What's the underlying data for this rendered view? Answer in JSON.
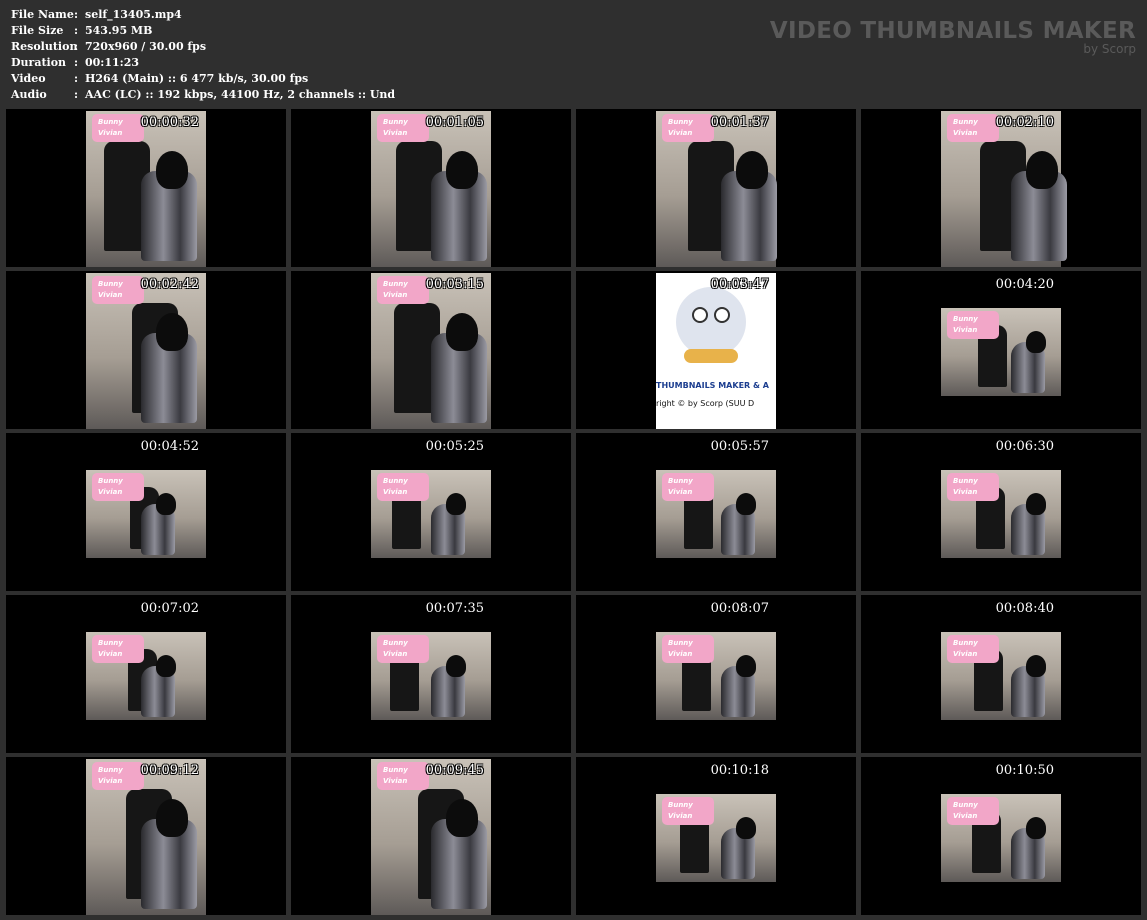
{
  "info": [
    {
      "label": "File Name",
      "sep": ":",
      "value": "self_13405.mp4"
    },
    {
      "label": "File Size",
      "sep": ":",
      "value": "543.95 MB"
    },
    {
      "label": "Resolution",
      "sep": ":",
      "value": "720x960 / 30.00 fps"
    },
    {
      "label": "Duration",
      "sep": ":",
      "value": "00:11:23"
    },
    {
      "label": "Video",
      "sep": ":",
      "value": "H264 (Main) :: 6 477 kb/s, 30.00 fps"
    },
    {
      "label": "Audio",
      "sep": ":",
      "value": "AAC (LC) :: 192 kbps, 44100 Hz, 2 channels :: Und"
    }
  ],
  "brand": {
    "title": "VIDEO THUMBNAILS MAKER",
    "subtitle": "by Scorp"
  },
  "badge": {
    "line1": "Bunny",
    "line2": "Vivian"
  },
  "logo": {
    "text": "THUMBNAILS MAKER & A",
    "copyright": "right © by Scorp (SUU D"
  },
  "thumbnails": [
    {
      "time": "00:00:32",
      "kind": "portrait"
    },
    {
      "time": "00:01:05",
      "kind": "portrait"
    },
    {
      "time": "00:01:37",
      "kind": "portrait"
    },
    {
      "time": "00:02:10",
      "kind": "portrait"
    },
    {
      "time": "00:02:42",
      "kind": "portrait"
    },
    {
      "time": "00:03:15",
      "kind": "portrait"
    },
    {
      "time": "00:03:47",
      "kind": "logo"
    },
    {
      "time": "00:04:20",
      "kind": "landscape"
    },
    {
      "time": "00:04:52",
      "kind": "landscape"
    },
    {
      "time": "00:05:25",
      "kind": "landscape"
    },
    {
      "time": "00:05:57",
      "kind": "landscape"
    },
    {
      "time": "00:06:30",
      "kind": "landscape"
    },
    {
      "time": "00:07:02",
      "kind": "landscape"
    },
    {
      "time": "00:07:35",
      "kind": "landscape"
    },
    {
      "time": "00:08:07",
      "kind": "landscape"
    },
    {
      "time": "00:08:40",
      "kind": "landscape"
    },
    {
      "time": "00:09:12",
      "kind": "portrait"
    },
    {
      "time": "00:09:45",
      "kind": "portrait"
    },
    {
      "time": "00:10:18",
      "kind": "landscape"
    },
    {
      "time": "00:10:50",
      "kind": "landscape"
    }
  ]
}
